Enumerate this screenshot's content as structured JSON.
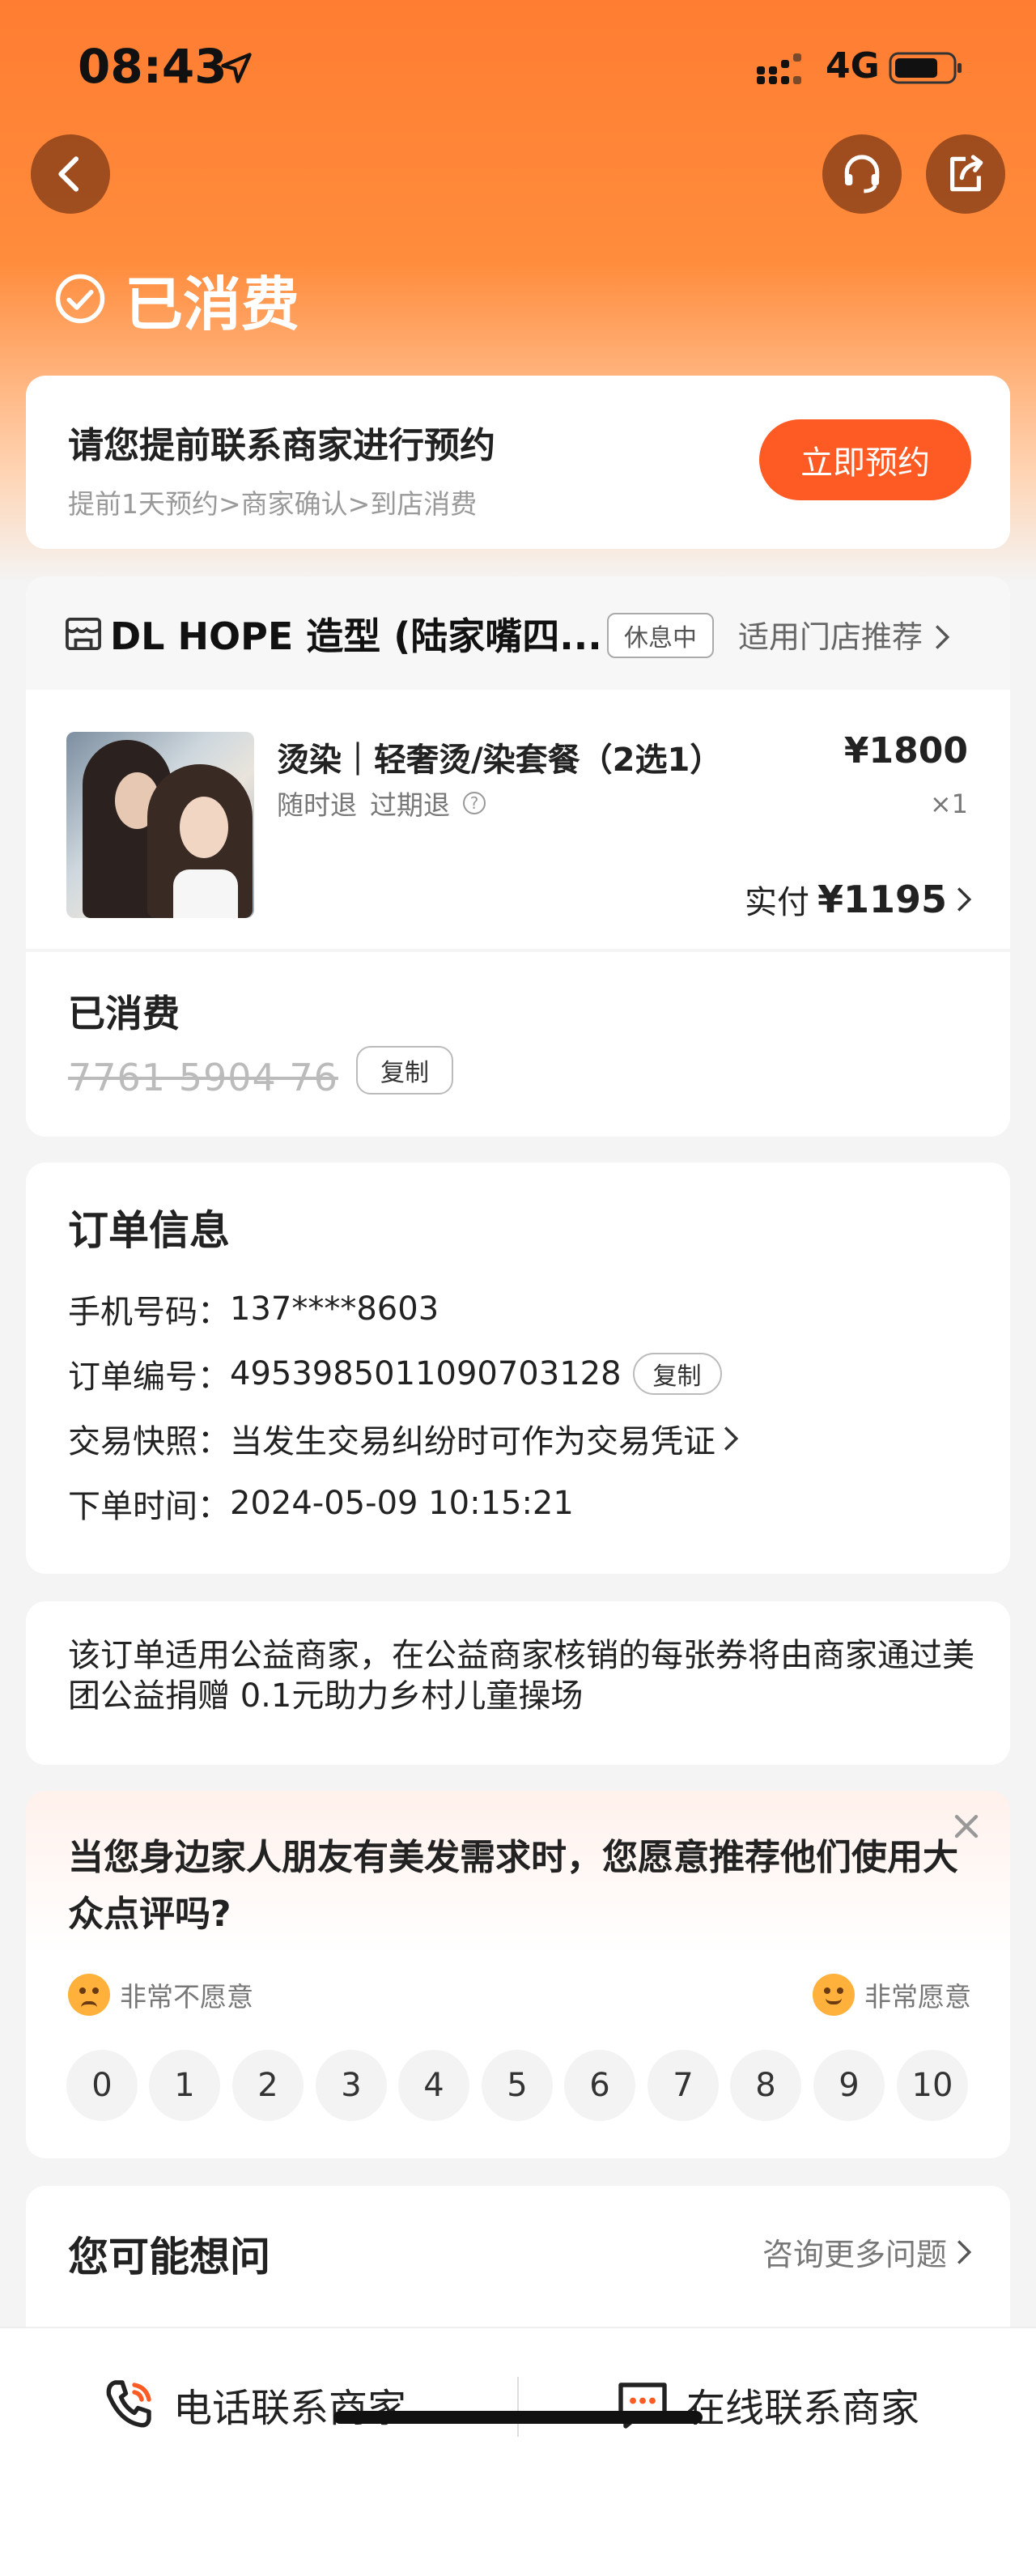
{
  "status_bar": {
    "time": "08:43",
    "network": "4G"
  },
  "header": {
    "status": "已消费"
  },
  "reserve": {
    "title": "请您提前联系商家进行预约",
    "steps": "提前1天预约>商家确认>到店消费",
    "button": "立即预约"
  },
  "shop": {
    "name": "DL HOPE 造型 (陆家嘴四...",
    "badge": "休息中",
    "recommend": "适用门店推荐"
  },
  "product": {
    "title": "烫染｜轻奢烫/染套餐（2选1）",
    "tags": [
      "随时退",
      "过期退"
    ],
    "price": "¥1800",
    "qty": "×1",
    "paid_label": "实付",
    "paid_value": "¥1195"
  },
  "coupon": {
    "status": "已消费",
    "code": "7761 5904 76",
    "copy": "复制"
  },
  "order_info": {
    "title": "订单信息",
    "phone_label": "手机号码：",
    "phone": "137****8603",
    "order_label": "订单编号：",
    "order_no": "4953985011090703128",
    "copy": "复制",
    "snapshot_label": "交易快照：",
    "snapshot": "当发生交易纠纷时可作为交易凭证",
    "time_label": "下单时间：",
    "time": "2024-05-09 10:15:21"
  },
  "charity": {
    "text": "该订单适用公益商家，在公益商家核销的每张券将由商家通过美团公益捐赠 0.1元助力乡村儿童操场"
  },
  "survey": {
    "question": "当您身边家人朋友有美发需求时，您愿意推荐他们使用大众点评吗?",
    "low_label": "非常不愿意",
    "high_label": "非常愿意",
    "scores": [
      "0",
      "1",
      "2",
      "3",
      "4",
      "5",
      "6",
      "7",
      "8",
      "9",
      "10"
    ]
  },
  "faq": {
    "title": "您可能想问",
    "more": "咨询更多问题"
  },
  "bottom": {
    "call": "电话联系商家",
    "chat": "在线联系商家"
  },
  "colors": {
    "accent": "#fe5b24",
    "header_gradient_top": "#ff7d32"
  },
  "icons": [
    "location-arrow-icon",
    "signal-icon",
    "battery-icon",
    "back-icon",
    "headset-icon",
    "share-icon",
    "check-circle-icon",
    "shop-icon",
    "question-icon",
    "chevron-right-icon",
    "close-icon",
    "phone-icon",
    "chat-icon"
  ]
}
